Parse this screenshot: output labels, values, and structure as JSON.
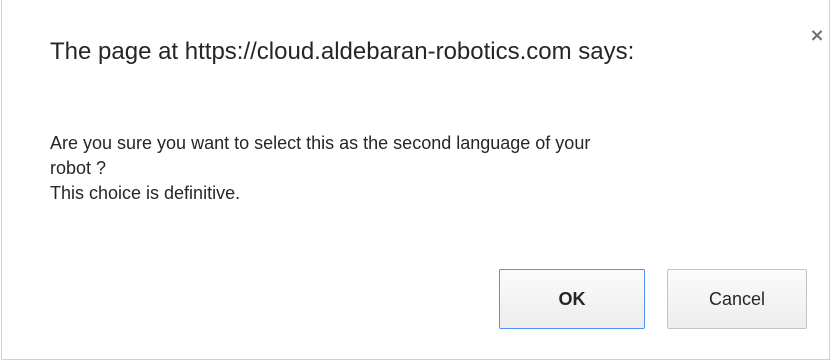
{
  "dialog": {
    "title": "The page at https://cloud.aldebaran-robotics.com says:",
    "close_icon": "close-icon",
    "message_lines": [
      "Are you sure you want to select this as the second language of your",
      "robot ?",
      "This choice is definitive."
    ],
    "ok_label": "OK",
    "cancel_label": "Cancel",
    "colors": {
      "ok_border": "#4d90fe",
      "text": "#262626"
    }
  }
}
